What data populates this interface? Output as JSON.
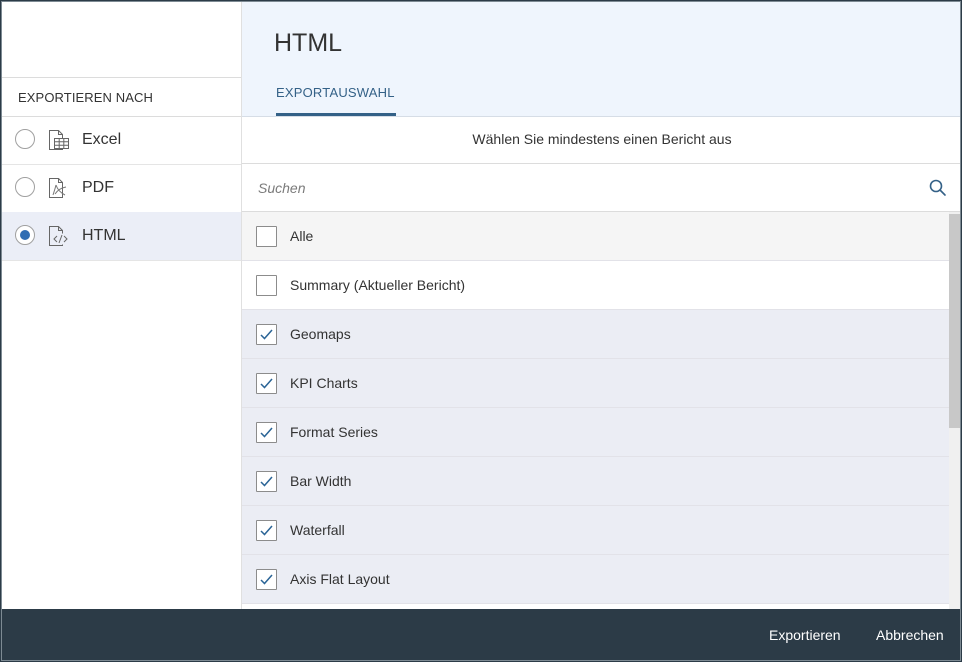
{
  "sidebar": {
    "heading": "EXPORTIEREN NACH",
    "options": [
      {
        "label": "Excel",
        "icon": "excel-file-icon",
        "selected": false
      },
      {
        "label": "PDF",
        "icon": "pdf-file-icon",
        "selected": false
      },
      {
        "label": "HTML",
        "icon": "html-file-icon",
        "selected": true
      }
    ]
  },
  "header": {
    "title": "HTML",
    "tab_label": "EXPORTAUSWAHL"
  },
  "info_text": "Wählen Sie mindestens einen Bericht aus",
  "search": {
    "placeholder": "Suchen",
    "value": "",
    "icon": "search-icon"
  },
  "reports": [
    {
      "label": "Alle",
      "checked": false
    },
    {
      "label": "Summary (Aktueller Bericht)",
      "checked": false
    },
    {
      "label": "Geomaps",
      "checked": true
    },
    {
      "label": "KPI Charts",
      "checked": true
    },
    {
      "label": "Format Series",
      "checked": true
    },
    {
      "label": "Bar Width",
      "checked": true
    },
    {
      "label": "Waterfall",
      "checked": true
    },
    {
      "label": "Axis Flat Layout",
      "checked": true
    }
  ],
  "footer": {
    "export_label": "Exportieren",
    "cancel_label": "Abbrechen"
  },
  "colors": {
    "accent": "#346187",
    "radio_selected": "#2f6db3",
    "footer_bg": "#2c3b47",
    "header_bg": "#eff5fd",
    "selected_row_bg": "#ebedf4"
  }
}
